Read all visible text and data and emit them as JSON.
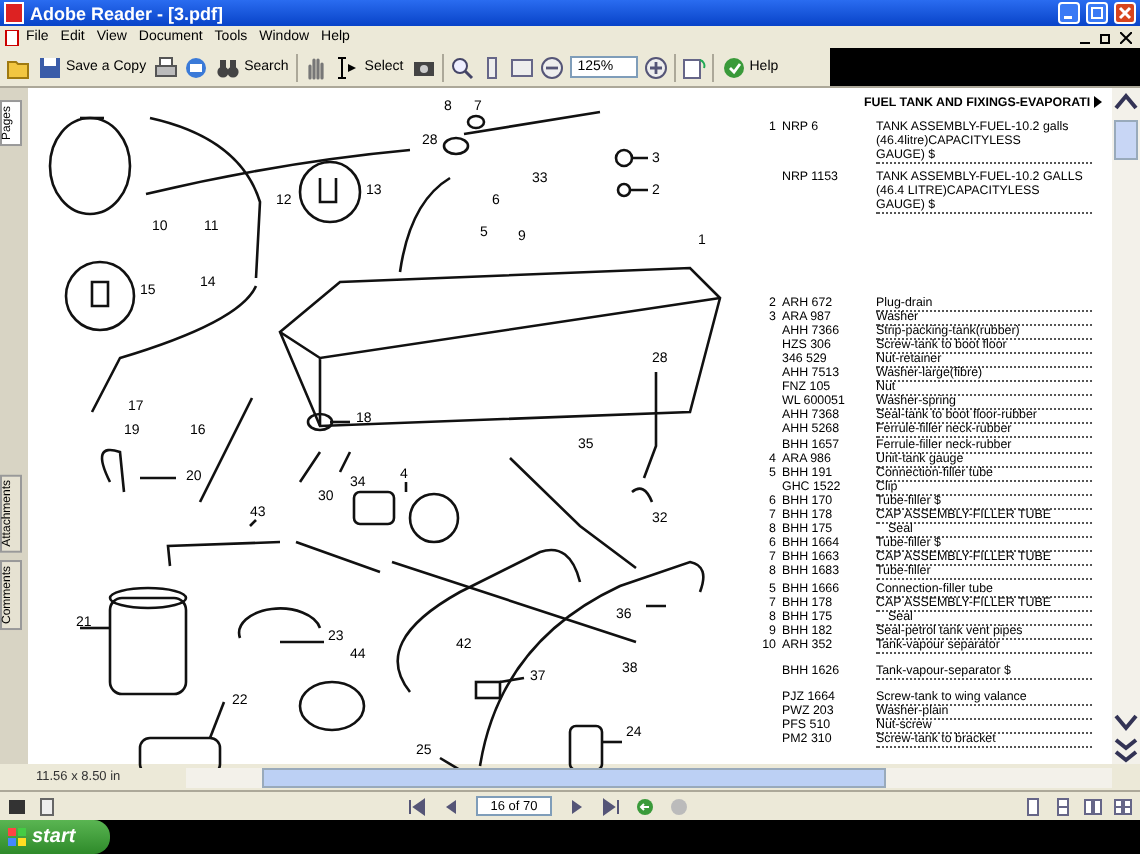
{
  "window": {
    "title": "Adobe Reader - [3.pdf]"
  },
  "menu": [
    "File",
    "Edit",
    "View",
    "Document",
    "Tools",
    "Window",
    "Help"
  ],
  "toolbar": {
    "save_label": "Save a Copy",
    "search_label": "Search",
    "select_label": "Select",
    "zoom": "125%",
    "help_label": "Help"
  },
  "side_tabs": [
    {
      "label": "Pages",
      "selected": true
    },
    {
      "label": "Attachments",
      "selected": false
    },
    {
      "label": "Comments",
      "selected": false
    }
  ],
  "callouts": [
    "8",
    "7",
    "28",
    "6",
    "5",
    "3",
    "2",
    "33",
    "9",
    "1",
    "10",
    "11",
    "12",
    "13",
    "14",
    "15",
    "16",
    "17",
    "19",
    "18",
    "20",
    "28",
    "30",
    "34",
    "4",
    "35",
    "32",
    "43",
    "21",
    "23",
    "44",
    "42",
    "36",
    "37",
    "38",
    "22",
    "24",
    "25"
  ],
  "parts_list": {
    "header": "FUEL TANK AND FIXINGS-EVAPORATI",
    "groups": [
      [
        {
          "ref": "1",
          "part": "NRP 6",
          "desc": "TANK ASSEMBLY-FUEL-10.2 galls\n(46.4litre)CAPACITYLESS\nGAUGE) $",
          "indent": false
        }
      ],
      [
        {
          "part": "NRP 1153",
          "desc": "TANK ASSEMBLY-FUEL-10.2 GALLS\n(46.4 LITRE)CAPACITYLESS\nGAUGE) $",
          "indent": false
        }
      ],
      [
        {
          "ref": "2",
          "part": "ARH 672",
          "desc": "Plug-drain",
          "indent": false
        },
        {
          "ref": "3",
          "part": "ARA 987",
          "desc": "Washer",
          "indent": false
        },
        {
          "part": "AHH 7366",
          "desc": "Strip-packing-tank(rubber)",
          "indent": false
        },
        {
          "part": "HZS 306",
          "desc": "Screw-tank to boot floor",
          "indent": false
        },
        {
          "part": "346 529",
          "desc": "Nut-retainer",
          "indent": false
        },
        {
          "part": "AHH 7513",
          "desc": "Washer-large(fibre)",
          "indent": false
        },
        {
          "part": "FNZ 105",
          "desc": "Nut",
          "indent": false
        },
        {
          "part": "WL 600051",
          "desc": "Washer-spring",
          "indent": false
        },
        {
          "part": "AHH 7368",
          "desc": "Seal-tank to boot floor-rubber",
          "indent": false
        },
        {
          "part": "AHH 5268",
          "desc": "Ferrule-filler neck-rubber",
          "indent": false
        }
      ],
      [
        {
          "part": "BHH 1657",
          "desc": "Ferrule-filler neck-rubber",
          "indent": false
        },
        {
          "ref": "4",
          "part": "ARA 986",
          "desc": "Unit-tank gauge",
          "indent": false
        },
        {
          "ref": "5",
          "part": "BHH 191",
          "desc": "Connection-filler tube",
          "indent": false
        },
        {
          "part": "GHC 1522",
          "desc": "Clip",
          "indent": false
        },
        {
          "ref": "6",
          "part": "BHH 170",
          "desc": "Tube-filler $",
          "indent": false
        },
        {
          "ref": "7",
          "part": "BHH 178",
          "desc": "CAP ASSEMBLY-FILLER TUBE",
          "indent": false
        },
        {
          "ref": "8",
          "part": "BHH 175",
          "desc": "Seal",
          "indent": true
        },
        {
          "ref": "6",
          "part": "BHH 1664",
          "desc": "Tube-filler $",
          "indent": false
        },
        {
          "ref": "7",
          "part": "BHH 1663",
          "desc": "CAP ASSEMBLY-FILLER TUBE",
          "indent": false
        },
        {
          "ref": "8",
          "part": "BHH 1683",
          "desc": "Tube-filler",
          "indent": false
        }
      ],
      [
        {
          "ref": "5",
          "part": "BHH 1666",
          "desc": "Connection-filler tube",
          "indent": false
        },
        {
          "ref": "7",
          "part": "BHH 178",
          "desc": "CAP ASSEMBLY-FILLER TUBE",
          "indent": false
        },
        {
          "ref": "8",
          "part": "BHH 175",
          "desc": "Seal",
          "indent": true
        },
        {
          "ref": "9",
          "part": "BHH 182",
          "desc": "Seal-petrol tank vent pipes",
          "indent": false
        },
        {
          "ref": "10",
          "part": "ARH 352",
          "desc": "Tank-vapour separator",
          "indent": false
        }
      ],
      [
        {
          "part": "BHH 1626",
          "desc": "Tank-vapour-separator $",
          "indent": false
        }
      ],
      [
        {
          "part": "PJZ 1664",
          "desc": "Screw-tank to wing valance",
          "indent": false
        },
        {
          "part": "PWZ 203",
          "desc": "Washer-plain",
          "indent": false
        },
        {
          "part": "PFS 510",
          "desc": "Nut-screw",
          "indent": false
        },
        {
          "part": "PM2 310",
          "desc": "Screw-tank to bracket",
          "indent": false
        }
      ]
    ]
  },
  "status": {
    "page_size": "11.56 x 8.50 in"
  },
  "nav": {
    "page_field": "16 of 70"
  },
  "taskbar": {
    "start": "start"
  }
}
